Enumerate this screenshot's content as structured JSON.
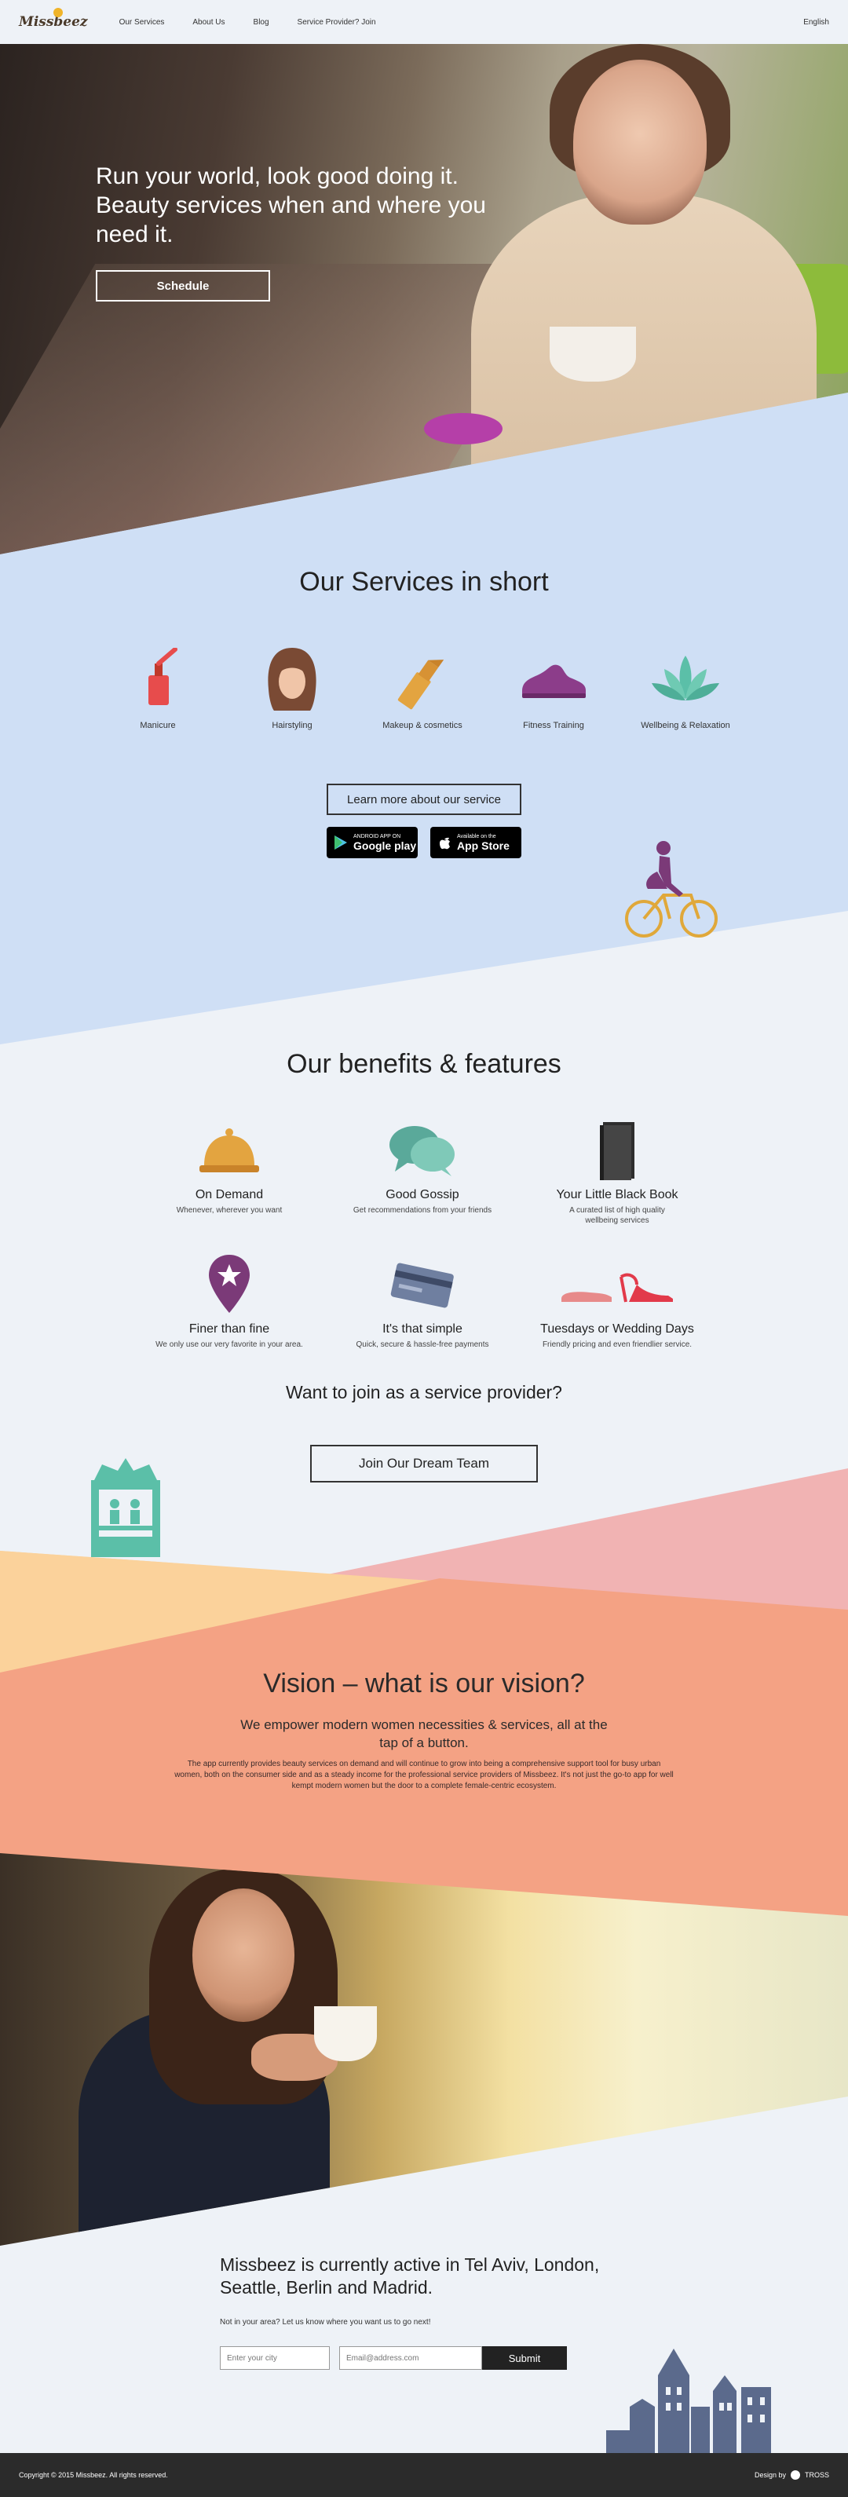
{
  "nav": {
    "logo": "Missbeez",
    "links": [
      "Our Services",
      "About Us",
      "Blog",
      "Service Provider? Join"
    ],
    "language": "English"
  },
  "hero": {
    "headline": "Run your world, look good doing it. Beauty services when and where you need it.",
    "cta": "Schedule"
  },
  "services": {
    "title": "Our Services in short",
    "items": [
      {
        "label": "Manicure",
        "icon": "nail-polish-icon"
      },
      {
        "label": "Hairstyling",
        "icon": "hair-icon"
      },
      {
        "label": "Makeup & cosmetics",
        "icon": "lipstick-icon"
      },
      {
        "label": "Fitness Training",
        "icon": "sneaker-icon"
      },
      {
        "label": "Wellbeing & Relaxation",
        "icon": "lotus-icon"
      }
    ],
    "learn_more": "Learn more about our service",
    "google_play_small": "ANDROID APP ON",
    "google_play_big": "Google play",
    "app_store_small": "Available on the",
    "app_store_big": "App Store"
  },
  "benefits": {
    "title": "Our benefits & features",
    "items": [
      {
        "title": "On Demand",
        "desc": "Whenever, wherever you want",
        "icon": "service-bell-icon"
      },
      {
        "title": "Good Gossip",
        "desc": "Get recommendations from your friends",
        "icon": "speech-bubbles-icon"
      },
      {
        "title": "Your Little Black Book",
        "desc": "A curated list of high quality wellbeing services",
        "icon": "black-book-icon"
      },
      {
        "title": "Finer than fine",
        "desc": "We only use our very favorite in your area.",
        "icon": "map-pin-star-icon"
      },
      {
        "title": "It's that simple",
        "desc": "Quick, secure & hassle-free payments",
        "icon": "credit-card-icon"
      },
      {
        "title": "Tuesdays or Wedding Days",
        "desc": "Friendly pricing and even friendlier service.",
        "icon": "shoes-icon"
      }
    ],
    "join_question": "Want to join as a service provider?",
    "join_button": "Join Our Dream Team"
  },
  "vision": {
    "title": "Vision – what is our vision?",
    "subtitle": "We empower modern women necessities & services, all at the tap of a button.",
    "body": "The app currently provides beauty services on demand and will continue to grow into being a comprehensive support tool for busy urban women, both on the consumer side and as a steady income for the professional service providers of Missbeez. It's not just the go-to app for well kempt modern women but the door to a complete female-centric ecosystem."
  },
  "active": {
    "title": "Missbeez is currently active in Tel Aviv, London, Seattle, Berlin and Madrid.",
    "subtitle": "Not in your area? Let us know where you want us to go next!",
    "city_placeholder": "Enter your city",
    "email_placeholder": "Email@address.com",
    "submit": "Submit"
  },
  "footer": {
    "copyright": "Copyright © 2015 Missbeez. All rights reserved.",
    "design_by": "Design by",
    "designer": "TROSS"
  },
  "colors": {
    "light_blue": "#cfdff5",
    "salmon": "#f4a284",
    "peach": "#fbd29b",
    "pink": "#f1b3b3",
    "teal": "#5bbfa8",
    "purple": "#7b3a78"
  }
}
